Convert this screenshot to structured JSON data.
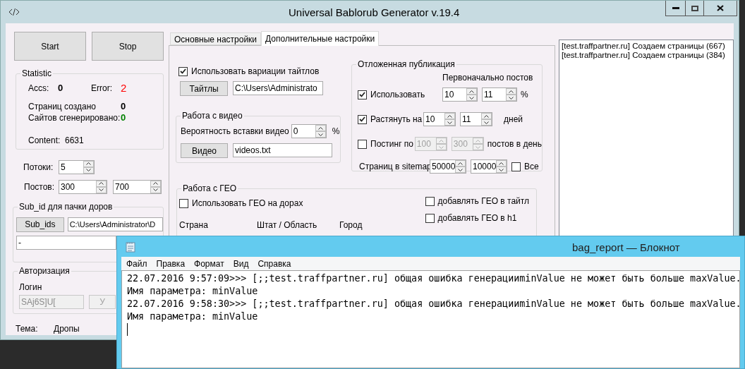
{
  "main_window": {
    "title": "Universal Bablorub Generator v.19.4",
    "buttons": [
      "Start",
      "Stop"
    ],
    "statistic": {
      "title": "Statistic",
      "accs_label": "Accs:",
      "accs": "0",
      "error_label": "Error:",
      "error": "2",
      "pages_label": "Страниц создано",
      "pages": "0",
      "sites_label": "Сайтов сгенерировано:",
      "sites": "0",
      "content_label": "Content:",
      "content": "6631"
    },
    "threads": {
      "label": "Потоки:",
      "value": "5"
    },
    "posts": {
      "label": "Постов:",
      "min": "300",
      "max": "700"
    },
    "sub_id": {
      "title": "Sub_id для пачки доров",
      "button": "Sub_ids",
      "path": "C:\\Users\\Administrator\\D",
      "value": "-"
    },
    "auth": {
      "title": "Авторизация",
      "login_label": "Логин",
      "login": "SAj6S]U[",
      "disabled": true,
      "button": "У"
    },
    "theme": {
      "label": "Тема:",
      "value": "Дропы"
    },
    "tabs": [
      {
        "label": "Основные настройки",
        "selected": false
      },
      {
        "label": "Дополнительные настройки",
        "selected": true
      }
    ],
    "titles": {
      "checkbox": {
        "label": "Использовать вариации тайтлов",
        "checked": true
      },
      "button": "Тайтлы",
      "path": "C:\\Users\\Administrato"
    },
    "video": {
      "title": "Работа с видео",
      "chance_label": "Вероятность вставки видео",
      "chance": "0",
      "unit": "%",
      "button": "Видео",
      "file": "videos.txt"
    },
    "delayed": {
      "title": "Отложенная публикация",
      "header": "Первоначально постов",
      "rows": [
        {
          "label": "Использовать",
          "checked": true,
          "from": "10",
          "to": "11",
          "unit": "%",
          "disabled": false
        },
        {
          "label": "Растянуть на",
          "checked": true,
          "from": "10",
          "to": "11",
          "unit": "дней",
          "disabled": false
        },
        {
          "label": "Постинг по",
          "checked": false,
          "from": "100",
          "to": "300",
          "unit": "постов в день",
          "disabled": true
        }
      ],
      "sitemap": {
        "label": "Страниц в sitemap",
        "from": "50000",
        "to": "10000",
        "all_label": "Все",
        "all_checked": false
      }
    },
    "geo": {
      "title": "Работа с ГЕО",
      "use": {
        "label": "Использовать ГЕО на дорах",
        "checked": false
      },
      "columns": [
        "Страна",
        "Штат / Область",
        "Город"
      ],
      "options": [
        {
          "label": "добавлять ГЕО в тайтл",
          "checked": false
        },
        {
          "label": "добавлять ГЕО в h1",
          "checked": false
        }
      ]
    },
    "log": [
      "[test.traffpartner.ru] Создаем страницы (667)",
      "[test.traffpartner.ru] Создаем страницы (384)"
    ]
  },
  "notepad": {
    "title": "bag_report — Блокнот",
    "menu": [
      "Файл",
      "Правка",
      "Формат",
      "Вид",
      "Справка"
    ],
    "lines": [
      "22.07.2016 9:57:09>>> [;;test.traffpartner.ru] общая ошибка генерацииminValue не может быть больше maxValue.",
      "Имя параметра: minValue",
      "22.07.2016 9:58:30>>> [;;test.traffpartner.ru] общая ошибка генерацииminValue не может быть больше maxValue.",
      "Имя параметра: minValue"
    ]
  }
}
